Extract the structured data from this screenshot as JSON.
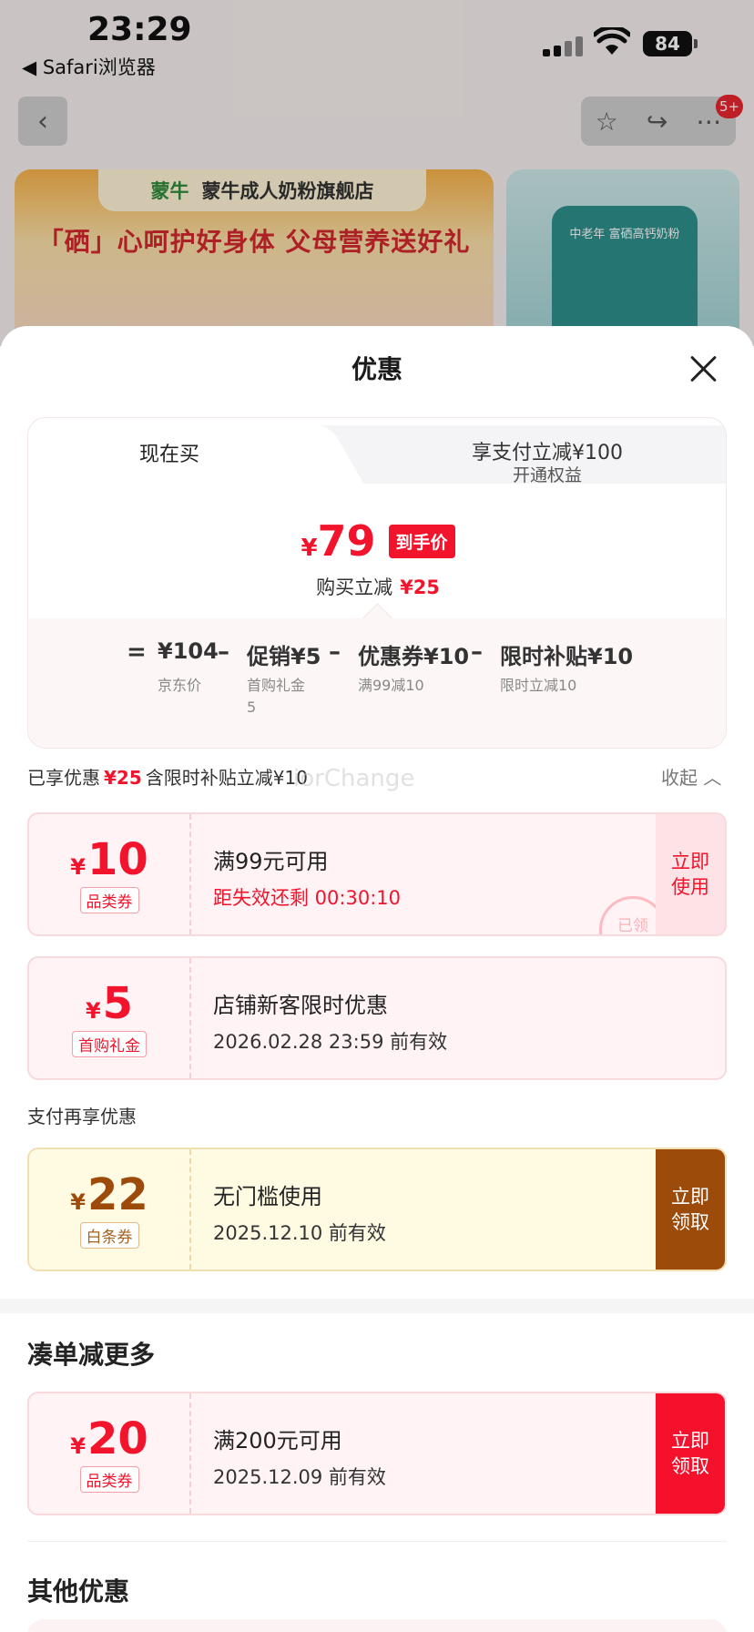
{
  "status_bar": {
    "time": "23:29",
    "back_app": "◀ Safari浏览器",
    "battery": "84"
  },
  "background": {
    "nav_badge": "5+",
    "banner_brand": "蒙牛",
    "banner_shop": "蒙牛成人奶粉旗舰店",
    "banner_slogan": "「硒」心呵护好身体 父母营养送好礼",
    "side_product": "中老年 富硒高钙奶粉"
  },
  "sheet": {
    "title": "优惠",
    "tabs": {
      "now": "现在买",
      "pay_title": "享支付立减¥100",
      "pay_sub": "开通权益"
    },
    "final": {
      "currency": "¥",
      "price": "79",
      "tag": "到手价",
      "reduce_label": "购买立减",
      "reduce_value": "¥25"
    },
    "formula": {
      "eq": "=",
      "jd_price": "¥104",
      "jd_label": "京东价",
      "minus": "–",
      "promo": "促销¥5",
      "promo_label": "首购礼金\n5",
      "coupon": "优惠券¥10",
      "coupon_label": "满99减10",
      "subsidy": "限时补贴¥10",
      "subsidy_label": "限时立减10"
    },
    "enjoyed": {
      "label": "已享优惠",
      "value": "¥25",
      "note": "含限时补贴立减¥10",
      "collapse": "收起",
      "watermark": "iorChange"
    },
    "coupons": [
      {
        "currency": "¥",
        "amount": "10",
        "tag": "品类券",
        "title": "满99元可用",
        "sub": "距失效还剩 00:30:10",
        "action": "立即\n使用",
        "stamp": "已领"
      },
      {
        "currency": "¥",
        "amount": "5",
        "tag": "首购礼金",
        "title": "店铺新客限时优惠",
        "sub": "2026.02.28 23:59 前有效"
      }
    ],
    "pay_more": {
      "label": "支付再享优惠",
      "coupon": {
        "currency": "¥",
        "amount": "22",
        "tag": "白条券",
        "title": "无门槛使用",
        "sub": "2025.12.10 前有效",
        "action": "立即\n领取"
      }
    },
    "combine": {
      "title": "凑单减更多",
      "coupon": {
        "currency": "¥",
        "amount": "20",
        "tag": "品类券",
        "title": "满200元可用",
        "sub": "2025.12.09 前有效",
        "action": "立即\n领取"
      }
    },
    "other": {
      "title": "其他优惠"
    }
  }
}
